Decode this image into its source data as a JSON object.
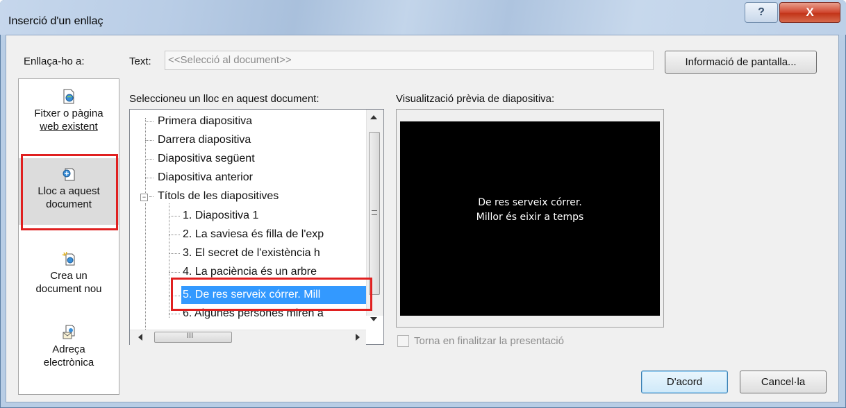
{
  "window": {
    "title": "Inserció d'un enllaç",
    "help_glyph": "?",
    "close_glyph": "X"
  },
  "link_to": {
    "label": "Enllaça-ho a:",
    "items": [
      {
        "label_line1": "Fitxer o pàgina",
        "label_line2": "web existent",
        "icon": "web-page-icon"
      },
      {
        "label_line1": "Lloc a aquest",
        "label_line2": "document",
        "icon": "place-in-document-icon",
        "selected": true
      },
      {
        "label_line1": "Crea un",
        "label_line2": "document nou",
        "icon": "new-document-icon"
      },
      {
        "label_line1": "Adreça",
        "label_line2": "electrònica",
        "icon": "email-icon"
      }
    ]
  },
  "text_field": {
    "label": "Text:",
    "value": "<<Selecció al document>>"
  },
  "screen_tip_button": "Informació de pantalla...",
  "place_select": {
    "label": "Seleccioneu un lloc en aquest document:",
    "items": [
      {
        "text": "Primera diapositiva",
        "level": 1
      },
      {
        "text": "Darrera diapositiva",
        "level": 1
      },
      {
        "text": "Diapositiva següent",
        "level": 1
      },
      {
        "text": "Diapositiva anterior",
        "level": 1
      },
      {
        "text": "Títols de les diapositives",
        "level": 1,
        "expanded": true
      },
      {
        "text": "1. Diapositiva 1",
        "level": 2
      },
      {
        "text": "2. La saviesa és filla  de l'exp",
        "level": 2
      },
      {
        "text": "3. El secret de l'existència h",
        "level": 2
      },
      {
        "text": "4. La paciència  és un arbre",
        "level": 2
      },
      {
        "text": "5. De res serveix córrer. Mill",
        "level": 2,
        "selected": true
      },
      {
        "text": "6. Algunes persones miren a",
        "level": 2
      }
    ],
    "hscroll_glyph": "III"
  },
  "preview": {
    "label": "Visualització prèvia de diapositiva:",
    "slide_line1": "De res serveix córrer.",
    "slide_line2": "Millor és eixir a temps"
  },
  "return_checkbox": {
    "label": "Torna en finalitzar la presentació",
    "checked": false
  },
  "buttons": {
    "ok": "D'acord",
    "cancel": "Cancel·la"
  }
}
